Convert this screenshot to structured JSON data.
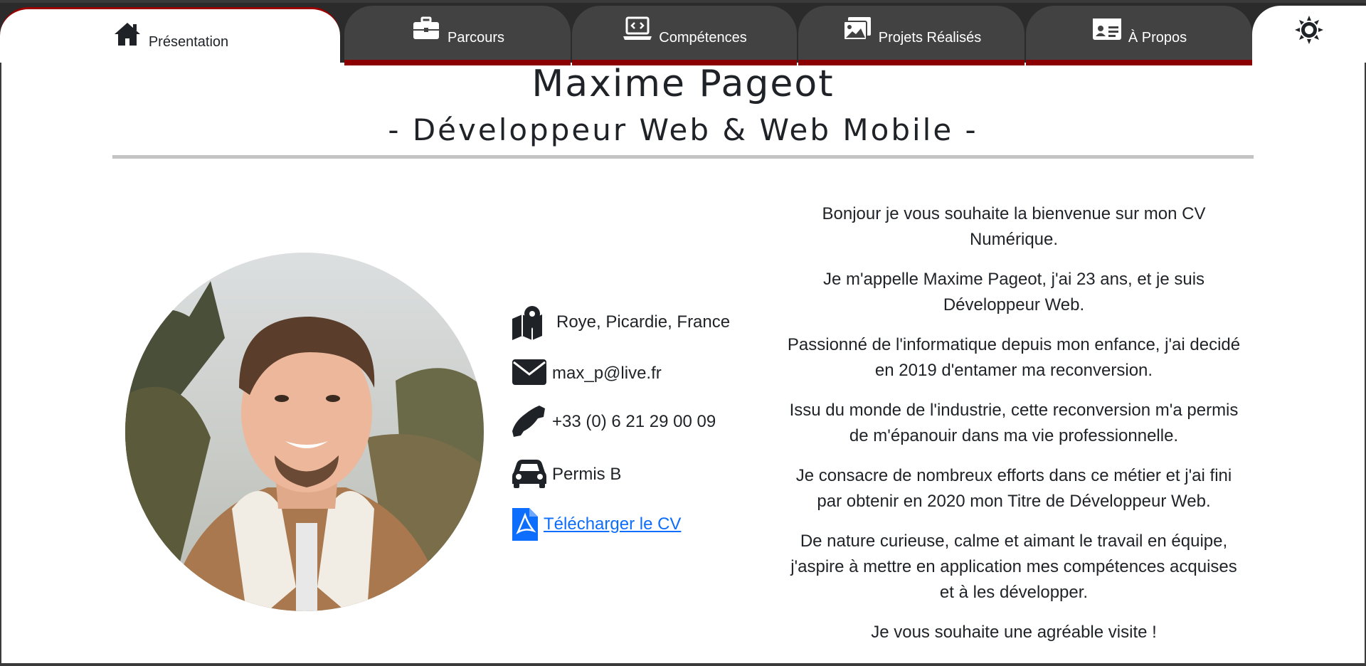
{
  "tabs": [
    {
      "label": "Présentation",
      "icon": "home-icon",
      "active": true
    },
    {
      "label": "Parcours",
      "icon": "briefcase-icon",
      "active": false
    },
    {
      "label": "Compétences",
      "icon": "laptop-code-icon",
      "active": false
    },
    {
      "label": "Projets Réalisés",
      "icon": "images-icon",
      "active": false
    },
    {
      "label": "À Propos",
      "icon": "id-card-icon",
      "active": false
    }
  ],
  "theme_toggle": {
    "icon": "sun-icon"
  },
  "colors": {
    "tabbar": "#2b2b2b",
    "tab": "#424242",
    "accent": "#8b0000",
    "link": "#0d6efd"
  },
  "header": {
    "name": "Maxime Pageot",
    "role": "- Développeur Web & Web Mobile -"
  },
  "photo": {
    "icon": "profile-photo"
  },
  "contact": {
    "location": "Roye, Picardie, France",
    "email": "max_p@live.fr",
    "phone": "+33 (0) 6 21 29 00 09",
    "license": "Permis B",
    "download_cv": "Télécharger le CV"
  },
  "intro": [
    "Bonjour je vous souhaite la bienvenue sur mon CV Numérique.",
    "Je m'appelle Maxime Pageot, j'ai 23 ans, et je suis Développeur Web.",
    "Passionné de l'informatique depuis mon enfance, j'ai decidé en 2019 d'entamer ma reconversion.",
    "Issu du monde de l'industrie, cette reconversion m'a permis de m'épanouir dans ma vie professionnelle.",
    "Je consacre de nombreux efforts dans ce métier et j'ai fini par obtenir en 2020 mon Titre de Développeur Web.",
    "De nature curieuse, calme et aimant le travail en équipe, j'aspire à mettre en application mes compétences acquises et à les développer.",
    "Je vous souhaite une agréable visite !"
  ]
}
